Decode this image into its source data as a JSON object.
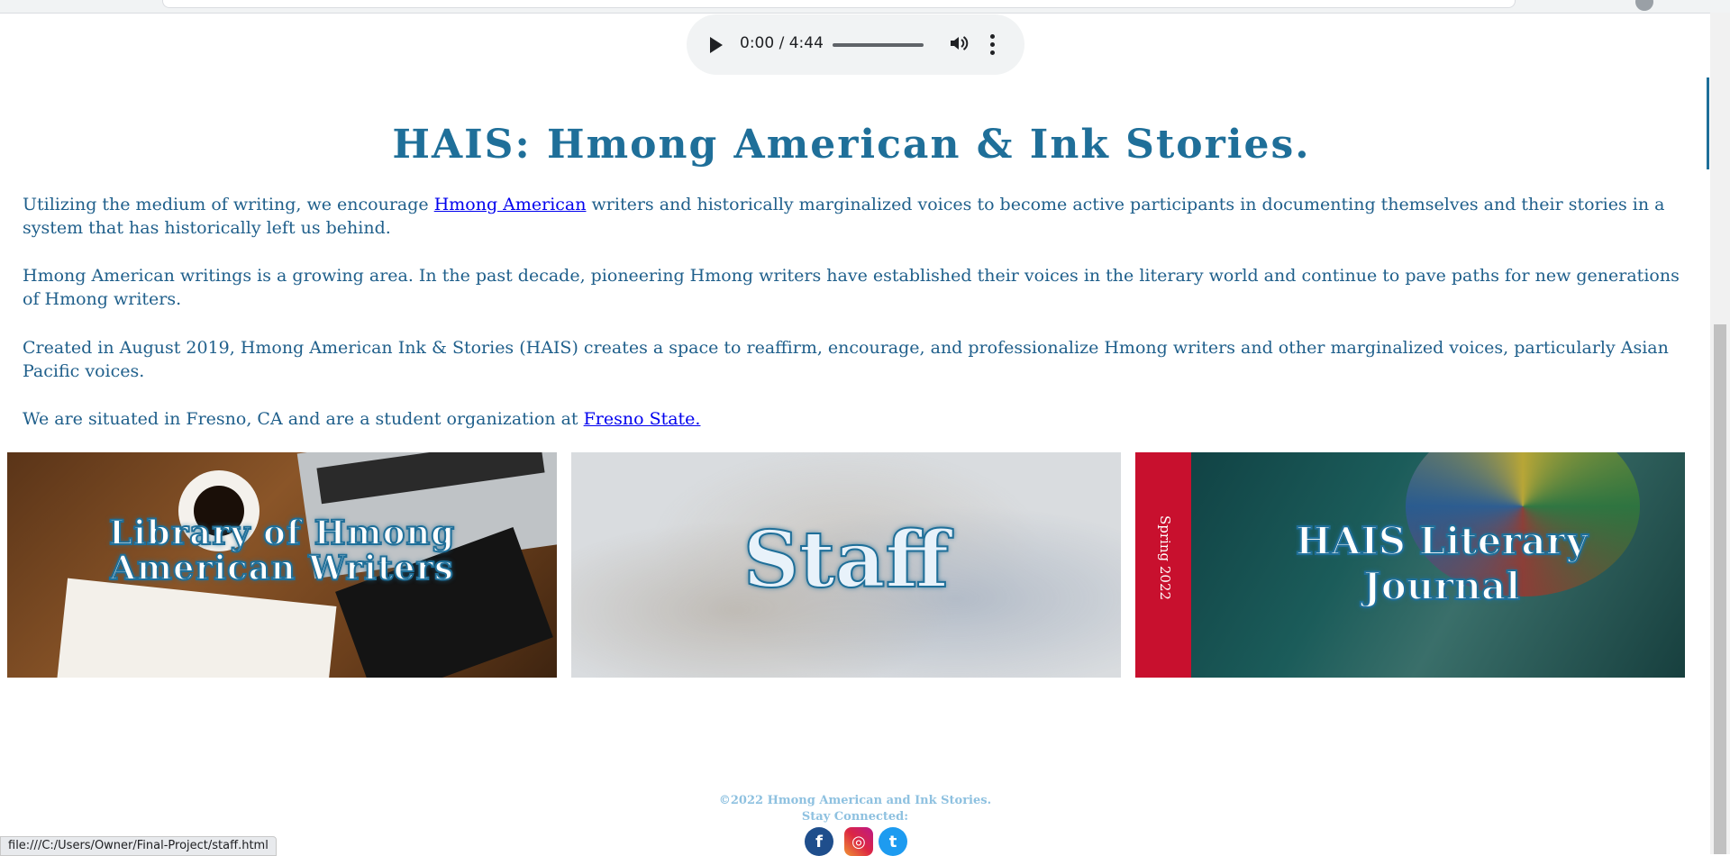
{
  "audio": {
    "time": "0:00 / 4:44"
  },
  "heading": "HAIS: Hmong American & Ink Stories.",
  "paragraphs": {
    "p1_before": "Utilizing the medium of writing, we encourage ",
    "p1_link": "Hmong American",
    "p1_after": " writers and historically marginalized voices to become active participants in documenting themselves and their stories in a system that has historically left us behind.",
    "p2": "Hmong American writings is a growing area. In the past decade, pioneering Hmong writers have established their voices in the literary world and continue to pave paths for new generations of Hmong writers.",
    "p3": "Created in August 2019, Hmong American Ink & Stories (HAIS) creates a space to reaffirm, encourage, and professionalize Hmong writers and other marginalized voices, particularly Asian Pacific voices.",
    "p4_before": "We are situated in Fresno, CA and are a student organization at ",
    "p4_link": "Fresno State."
  },
  "tiles": {
    "library_line1": "Library of Hmong",
    "library_line2": "American Writers",
    "staff": "Staff",
    "journal_line1": "HAIS Literary",
    "journal_line2": "Journal",
    "journal_spring": "Spring 2022"
  },
  "footer": {
    "copyright": "©2022 Hmong American and Ink Stories.",
    "stay_connected": "Stay Connected:"
  },
  "social": {
    "facebook": "f",
    "instagram": "◎",
    "twitter": "t"
  },
  "status_bar": {
    "url": "file:///C:/Users/Owner/Final-Project/staff.html"
  },
  "colors": {
    "accent": "#1f6f99",
    "text": "#1f5f8b",
    "link": "#0000ee",
    "footer": "#8ec1e0"
  }
}
